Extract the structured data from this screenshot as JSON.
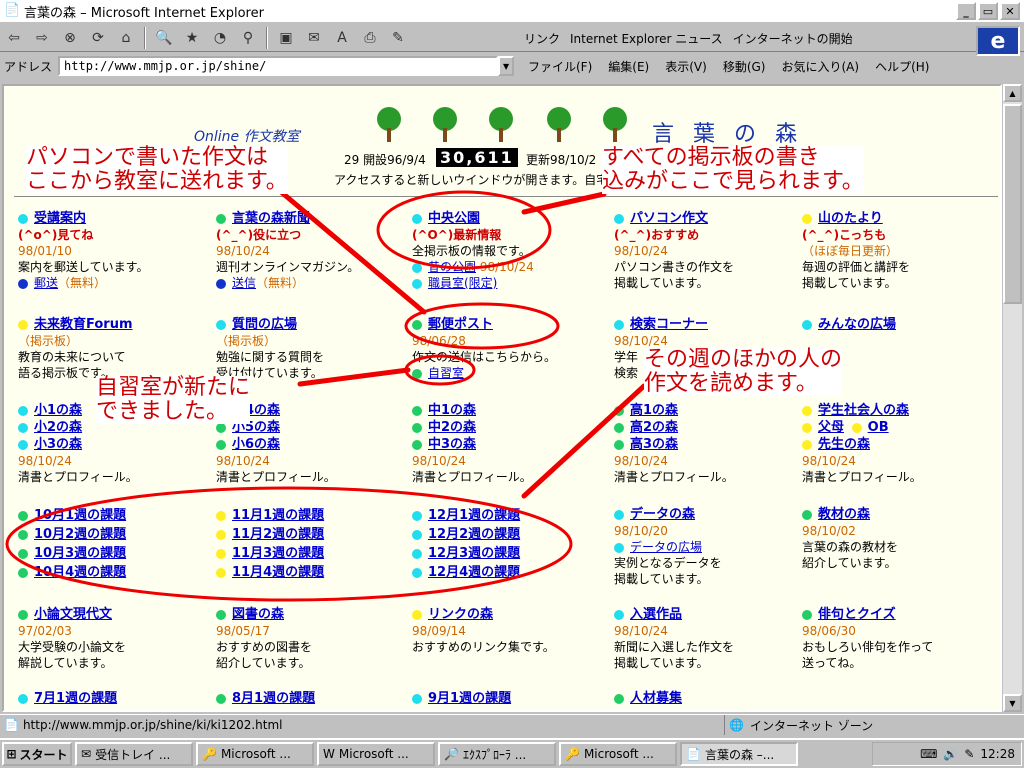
{
  "window": {
    "title": "言葉の森 – Microsoft Internet Explorer"
  },
  "toolbar": {
    "links_label": "リンク",
    "link1": "Internet Explorer ニュース",
    "link2": "インターネットの開始"
  },
  "address": {
    "label": "アドレス",
    "url": "http://www.mmjp.or.jp/shine/"
  },
  "menu": [
    "ファイル(F)",
    "編集(E)",
    "表示(V)",
    "移動(G)",
    "お気に入り(A)",
    "ヘルプ(H)"
  ],
  "page": {
    "logo_left": "Online 作文教室",
    "logo_right": "言 葉 の 森",
    "counter_prefix": "29 開設96/9/4",
    "counter": "30,611",
    "counter_suffix": "更新98/10/2",
    "note": "アクセスすると新しいウインドウが開きます。自宅から書"
  },
  "callouts": {
    "c1": "パソコンで書いた作文は\nここから教室に送れます。",
    "c2": "すべての掲示板の書き\n込みがここで見られます。",
    "c3": "その週のほかの人の\n作文を読めます。",
    "c4": "自習室が新たに\nできました。"
  },
  "row1": {
    "a": {
      "title": "受講案内",
      "sub": "(^o^)見てね",
      "date": "98/01/10",
      "desc": "案内を郵送しています。",
      "link": "郵送",
      "note": "（無料）"
    },
    "b": {
      "title": "言葉の森新聞",
      "sub": "(^_^)役に立つ",
      "date": "98/10/24",
      "desc": "週刊オンラインマガジン。",
      "link": "送信",
      "note": "（無料）"
    },
    "c": {
      "title": "中央公園",
      "sub": "(^O^)最新情報",
      "desc": "全掲示板の情報です。",
      "link1": "昔の公園",
      "date": "98/10/24",
      "link2": "職員室(限定)"
    },
    "d": {
      "title": "パソコン作文",
      "sub": "(^_^)おすすめ",
      "date": "98/10/24",
      "desc1": "パソコン書きの作文を",
      "desc2": "掲載しています。"
    },
    "e": {
      "title": "山のたより",
      "sub": "(^_^)こっちも",
      "note": "（ほぼ毎日更新）",
      "desc1": "毎週の評価と講評を",
      "desc2": "掲載しています。"
    }
  },
  "row2": {
    "a": {
      "title": "未来教育Forum",
      "note": "（掲示板）",
      "desc1": "教育の未来について",
      "desc2": "語る掲示板です。"
    },
    "b": {
      "title": "質問の広場",
      "note": "（掲示板）",
      "desc1": "勉強に関する質問を",
      "desc2": "受け付けています。"
    },
    "c": {
      "title": "郵便ポスト",
      "date": "98/06/28",
      "desc": "作文の送信はこちらから。",
      "link": "自習室"
    },
    "d": {
      "title": "検索コーナー",
      "date": "98/10/24",
      "desc1": "学年",
      "desc2": "検索"
    },
    "e": {
      "title": "みんなの広場"
    }
  },
  "row3": {
    "a": [
      "小1の森",
      "小2の森",
      "小3の森"
    ],
    "b": [
      "小4の森",
      "小5の森",
      "小6の森"
    ],
    "c": [
      "中1の森",
      "中2の森",
      "中3の森"
    ],
    "d": [
      "高1の森",
      "高2の森",
      "高3の森"
    ],
    "e": [
      "学生社会人の森",
      "父母",
      "OB",
      "先生の森"
    ],
    "date": "98/10/24",
    "desc": "清書とプロフィール。"
  },
  "row4": {
    "a": [
      "10月1週の課題",
      "10月2週の課題",
      "10月3週の課題",
      "10月4週の課題"
    ],
    "b": [
      "11月1週の課題",
      "11月2週の課題",
      "11月3週の課題",
      "11月4週の課題"
    ],
    "c": [
      "12月1週の課題",
      "12月2週の課題",
      "12月3週の課題",
      "12月4週の課題"
    ],
    "d": {
      "title": "データの森",
      "date": "98/10/20",
      "link": "データの広場",
      "desc1": "実例となるデータを",
      "desc2": "掲載しています。"
    },
    "e": {
      "title": "教材の森",
      "date": "98/10/02",
      "desc1": "言葉の森の教材を",
      "desc2": "紹介しています。"
    }
  },
  "row5": {
    "a": {
      "title": "小論文現代文",
      "date": "97/02/03",
      "desc1": "大学受験の小論文を",
      "desc2": "解説しています。"
    },
    "b": {
      "title": "図書の森",
      "date": "98/05/17",
      "desc1": "おすすめの図書を",
      "desc2": "紹介しています。"
    },
    "c": {
      "title": "リンクの森",
      "date": "98/09/14",
      "desc": "おすすめのリンク集です。"
    },
    "d": {
      "title": "入選作品",
      "date": "98/10/24",
      "desc1": "新聞に入選した作文を",
      "desc2": "掲載しています。"
    },
    "e": {
      "title": "俳句とクイズ",
      "date": "98/06/30",
      "desc1": "おもしろい俳句を作って",
      "desc2": "送ってね。"
    }
  },
  "row6": {
    "a": "7月1週の課題",
    "b": "8月1週の課題",
    "c": "9月1週の課題",
    "d": "人材募集"
  },
  "status": {
    "url": "http://www.mmjp.or.jp/shine/ki/ki1202.html",
    "zone": "インターネット ゾーン"
  },
  "taskbar": {
    "start": "スタート",
    "tasks": [
      "受信トレイ ...",
      "Microsoft ...",
      "Microsoft ...",
      "ｴｸｽﾌﾟﾛｰﾗ ...",
      "Microsoft ...",
      "言葉の森 –..."
    ],
    "clock": "12:28"
  }
}
